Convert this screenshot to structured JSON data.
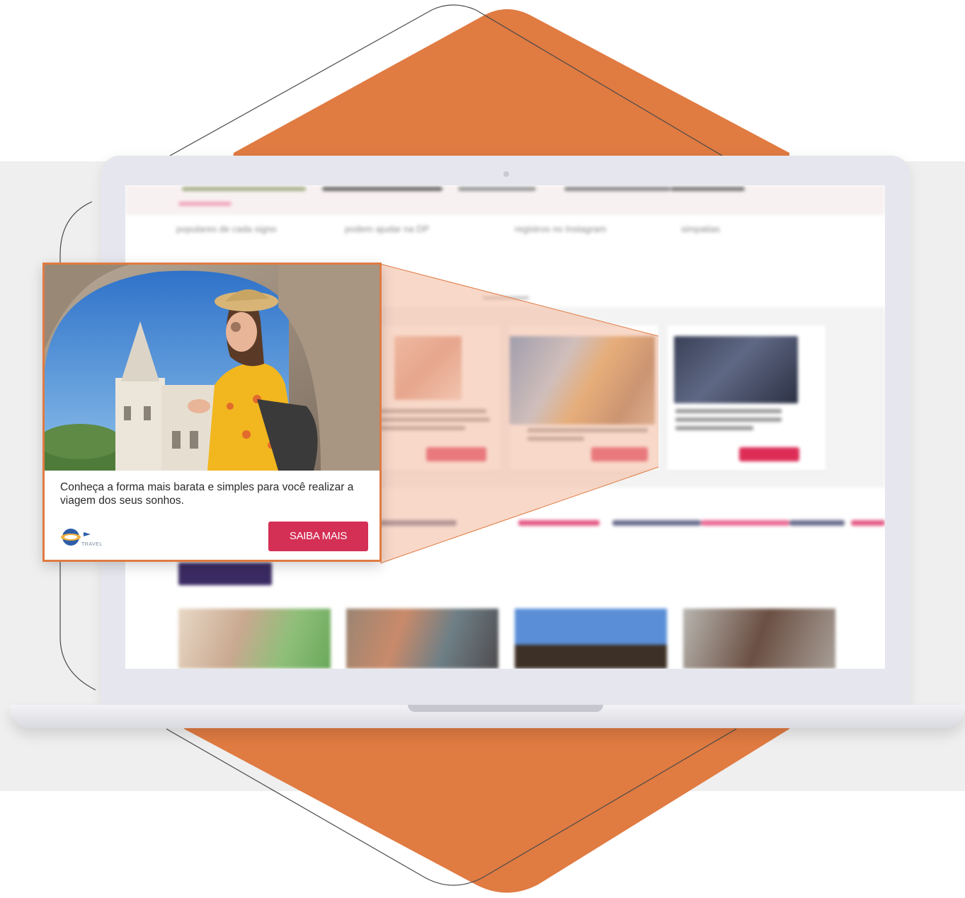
{
  "colors": {
    "accent_orange": "#e07b42",
    "cta_red": "#d42f55",
    "laptop_bezel": "#e6e7ee",
    "ad_band_background": "#f3f3f3"
  },
  "background_site": {
    "nav_links": [
      "populares de cada signo",
      "podem ajudar na DP",
      "registros no Instagram",
      "simpatias"
    ]
  },
  "ad": {
    "description": "Conheça a forma mais barata e simples para você realizar a viagem dos seus sonhos.",
    "cta_label": "SAIBA MAIS",
    "logo_caption": "TRAVEL",
    "icons": {
      "logo": "globe-airplane-logo-icon"
    }
  }
}
